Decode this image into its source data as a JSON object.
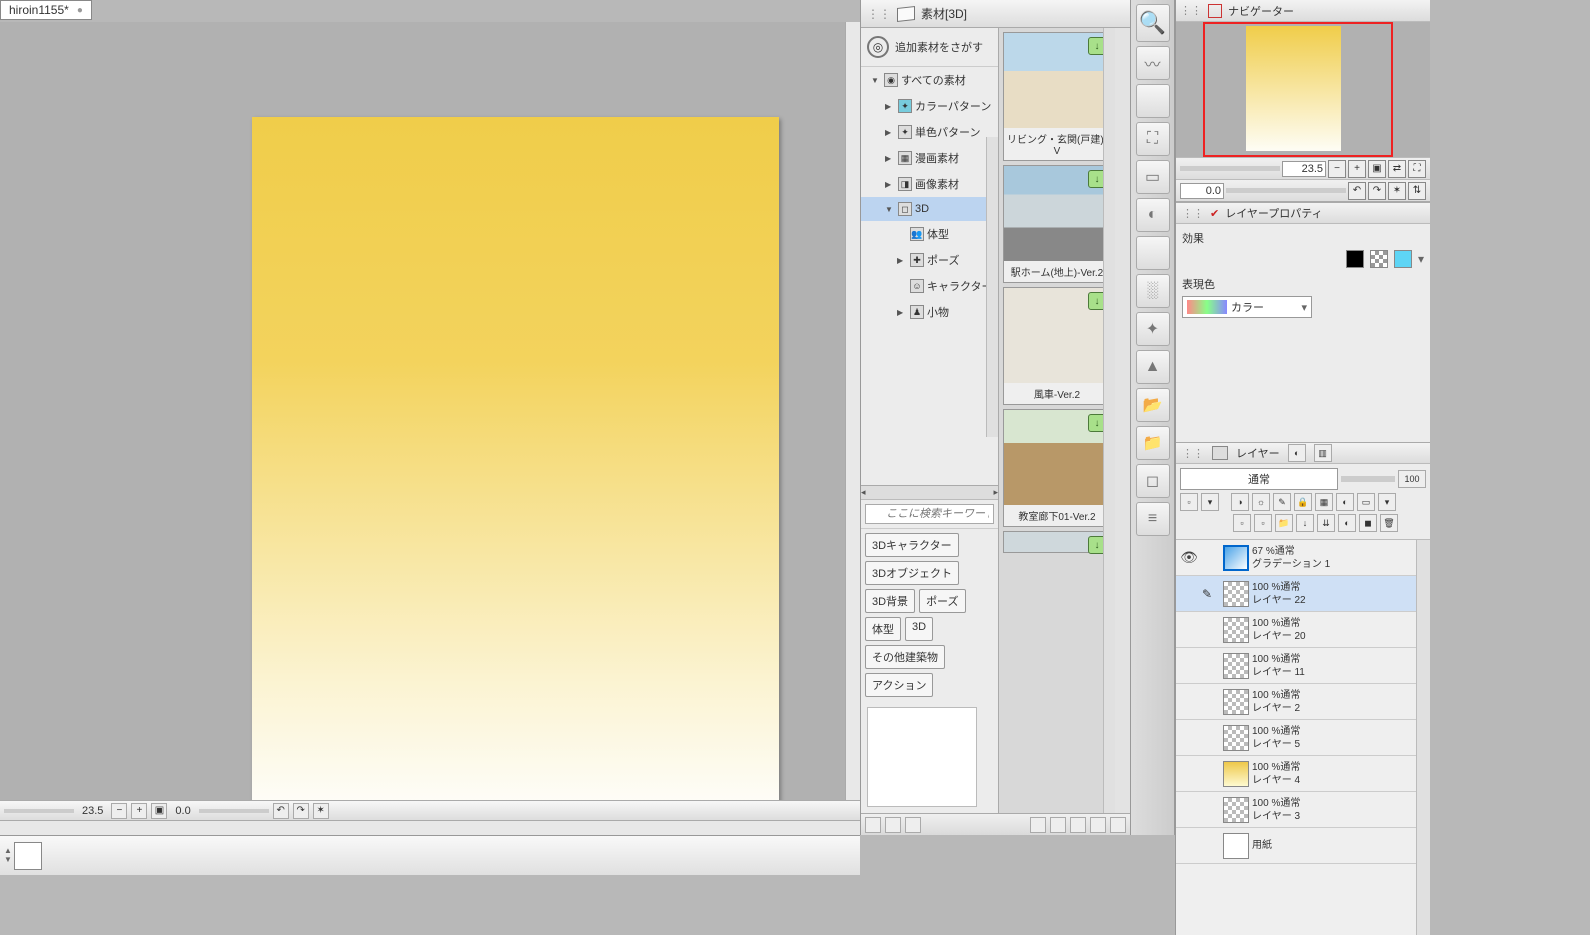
{
  "document": {
    "tab_name": "hiroin1155*"
  },
  "canvas_controls": {
    "zoom": "23.5",
    "rotate": "0.0"
  },
  "materials": {
    "title": "素材[3D]",
    "add_label": "追加素材をさがす",
    "tree_root": "すべての素材",
    "tree": [
      {
        "label": "カラーパターン"
      },
      {
        "label": "単色パターン"
      },
      {
        "label": "漫画素材"
      },
      {
        "label": "画像素材"
      },
      {
        "label": "3D",
        "selected": true
      },
      {
        "label": "体型"
      },
      {
        "label": "ポーズ"
      },
      {
        "label": "キャラクター"
      },
      {
        "label": "小物"
      }
    ],
    "search_placeholder": "ここに検索キーワードを入力",
    "tags": [
      "3Dキャラクター",
      "3Dオブジェクト",
      "3D背景",
      "ポーズ",
      "体型",
      "3D",
      "その他建築物",
      "アクション"
    ],
    "thumbs": [
      {
        "caption": "リビング・玄関(戸建)-V"
      },
      {
        "caption": "駅ホーム(地上)-Ver.2"
      },
      {
        "caption": "風車-Ver.2"
      },
      {
        "caption": "教室廊下01-Ver.2"
      }
    ]
  },
  "navigator": {
    "title": "ナビゲーター",
    "zoom": "23.5",
    "rotate": "0.0"
  },
  "layer_prop": {
    "title": "レイヤープロパティ",
    "section_effect": "効果",
    "section_color": "表現色",
    "color_mode": "カラー"
  },
  "layers": {
    "title": "レイヤー",
    "blend_mode": "通常",
    "opacity": "100",
    "list": [
      {
        "opacity": "67 %通常",
        "name": "グラデーション 1",
        "thumb": "grad",
        "visible": true
      },
      {
        "opacity": "100 %通常",
        "name": "レイヤー 22",
        "thumb": "check",
        "selected": true,
        "editing": true
      },
      {
        "opacity": "100 %通常",
        "name": "レイヤー 20",
        "thumb": "check"
      },
      {
        "opacity": "100 %通常",
        "name": "レイヤー 11",
        "thumb": "check"
      },
      {
        "opacity": "100 %通常",
        "name": "レイヤー 2",
        "thumb": "check"
      },
      {
        "opacity": "100 %通常",
        "name": "レイヤー 5",
        "thumb": "check"
      },
      {
        "opacity": "100 %通常",
        "name": "レイヤー 4",
        "thumb": "yel"
      },
      {
        "opacity": "100 %通常",
        "name": "レイヤー 3",
        "thumb": "check"
      },
      {
        "opacity": "",
        "name": "用紙",
        "thumb": "white"
      }
    ]
  }
}
